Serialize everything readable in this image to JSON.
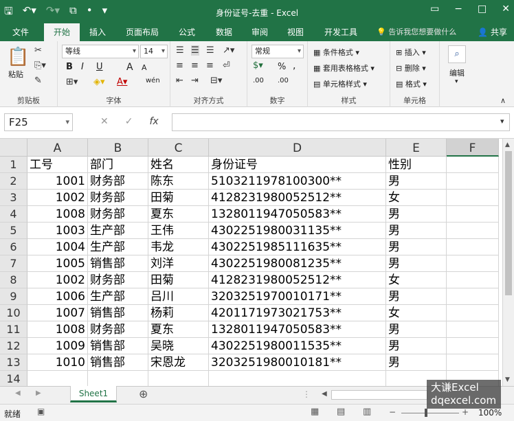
{
  "titlebar": {
    "title": "身份证号-去重 - Excel",
    "qat": [
      "save-icon",
      "undo-icon",
      "redo-icon",
      "camera-icon",
      "dot-icon",
      "customize-icon"
    ],
    "window_controls": {
      "restore": "▭",
      "minimize": "−",
      "maximize": "□",
      "close": "✕"
    }
  },
  "tabs": [
    "文件",
    "开始",
    "插入",
    "页面布局",
    "公式",
    "数据",
    "审阅",
    "视图",
    "开发工具"
  ],
  "active_tab": "开始",
  "tellme": "告诉我您想要做什么",
  "share": "共享",
  "ribbon": {
    "clipboard": {
      "paste": "粘贴",
      "label": "剪贴板"
    },
    "font": {
      "name": "等线",
      "size": "14",
      "bold": "B",
      "italic": "I",
      "underline": "U",
      "grow": "A",
      "shrink": "A",
      "label": "字体",
      "phonetic": "wén"
    },
    "alignment": {
      "label": "对齐方式"
    },
    "number": {
      "format": "常规",
      "percent": "%",
      "comma": ",",
      "label": "数字",
      "inc_decimal": ".00",
      "dec_decimal": ".00"
    },
    "styles": {
      "conditional": "条件格式",
      "table": "套用表格格式",
      "cell_styles": "单元格样式",
      "label": "样式"
    },
    "cells": {
      "insert": "插入",
      "delete": "删除",
      "format": "格式",
      "label": "单元格"
    },
    "editing": {
      "label": "编辑"
    }
  },
  "formula_bar": {
    "name_box": "F25",
    "fx": "fx",
    "value": ""
  },
  "columns": [
    "A",
    "B",
    "C",
    "D",
    "E",
    "F"
  ],
  "selected_column": "F",
  "rows": [
    {
      "n": "1",
      "a": "工号",
      "b": "部门",
      "c": "姓名",
      "d": "身份证号",
      "e": "性别"
    },
    {
      "n": "2",
      "a": "1001",
      "b": "财务部",
      "c": "陈东",
      "d": "5103211978100300**",
      "e": "男"
    },
    {
      "n": "3",
      "a": "1002",
      "b": "财务部",
      "c": "田菊",
      "d": "4128231980052512**",
      "e": "女"
    },
    {
      "n": "4",
      "a": "1008",
      "b": "财务部",
      "c": "夏东",
      "d": "1328011947050583**",
      "e": "男"
    },
    {
      "n": "5",
      "a": "1003",
      "b": "生产部",
      "c": "王伟",
      "d": "4302251980031135**",
      "e": "男"
    },
    {
      "n": "6",
      "a": "1004",
      "b": "生产部",
      "c": "韦龙",
      "d": "4302251985111635**",
      "e": "男"
    },
    {
      "n": "7",
      "a": "1005",
      "b": "销售部",
      "c": "刘洋",
      "d": "4302251980081235**",
      "e": "男"
    },
    {
      "n": "8",
      "a": "1002",
      "b": "财务部",
      "c": "田菊",
      "d": "4128231980052512**",
      "e": "女"
    },
    {
      "n": "9",
      "a": "1006",
      "b": "生产部",
      "c": "吕川",
      "d": "3203251970010171**",
      "e": "男"
    },
    {
      "n": "10",
      "a": "1007",
      "b": "销售部",
      "c": "杨莉",
      "d": "4201171973021753**",
      "e": "女"
    },
    {
      "n": "11",
      "a": "1008",
      "b": "财务部",
      "c": "夏东",
      "d": "1328011947050583**",
      "e": "男"
    },
    {
      "n": "12",
      "a": "1009",
      "b": "销售部",
      "c": "吴晓",
      "d": "4302251980011535**",
      "e": "男"
    },
    {
      "n": "13",
      "a": "1010",
      "b": "销售部",
      "c": "宋恩龙",
      "d": "3203251980010181**",
      "e": "男"
    },
    {
      "n": "14",
      "a": "",
      "b": "",
      "c": "",
      "d": "",
      "e": ""
    }
  ],
  "sheet_tab": "Sheet1",
  "add_sheet": "⊕",
  "status": {
    "ready": "就绪",
    "zoom": "100%",
    "minus": "−",
    "plus": "+"
  },
  "watermark": {
    "line1": "大谦Excel",
    "line2": "dqexcel.com"
  },
  "colors": {
    "accent": "#217346"
  }
}
